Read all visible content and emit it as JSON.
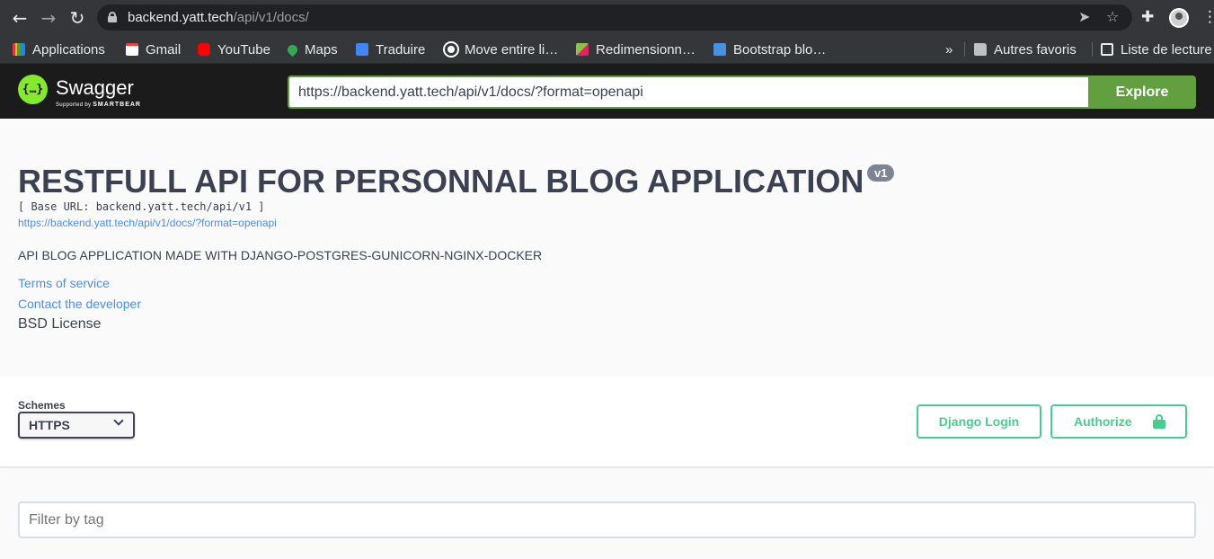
{
  "browser": {
    "url_host": "backend.yatt.tech",
    "url_path": "/api/v1/docs/",
    "bookmarks": [
      {
        "label": "Applications",
        "color": "#e53935"
      },
      {
        "label": "Gmail",
        "color": "#ea4335"
      },
      {
        "label": "YouTube",
        "color": "#ff0000"
      },
      {
        "label": "Maps",
        "color": "#34a853"
      },
      {
        "label": "Traduire",
        "color": "#4285f4"
      },
      {
        "label": "Move entire li…",
        "color": "#ffffff"
      },
      {
        "label": "Redimensionn…",
        "color": "#8bc34a"
      },
      {
        "label": "Bootstrap blo…",
        "color": "#4a90e2"
      }
    ],
    "overflow_label": "»",
    "other_bookmarks": "Autres favoris",
    "reading_list": "Liste de lecture"
  },
  "swagger": {
    "logo_glyph": "{…}",
    "brand": "Swagger",
    "supported_by": "Supported by",
    "smartbear": "SMARTBEAR",
    "spec_url": "https://backend.yatt.tech/api/v1/docs/?format=openapi",
    "explore_label": "Explore"
  },
  "info": {
    "title": "RESTFULL API FOR PERSONNAL BLOG APPLICATION",
    "version": "v1",
    "base_url": "[ Base URL: backend.yatt.tech/api/v1 ]",
    "spec_link": "https://backend.yatt.tech/api/v1/docs/?format=openapi",
    "description": "API BLOG APPLICATION MADE WITH DJANGO-POSTGRES-GUNICORN-NGINX-DOCKER",
    "terms": "Terms of service",
    "contact": "Contact the developer",
    "license": "BSD License"
  },
  "schemes": {
    "label": "Schemes",
    "selected": "HTTPS",
    "django_login": "Django Login",
    "authorize": "Authorize"
  },
  "filter": {
    "placeholder": "Filter by tag"
  },
  "colors": {
    "accent_green": "#49cc90",
    "swagger_green": "#62a03f",
    "link_blue": "#4990e2"
  }
}
